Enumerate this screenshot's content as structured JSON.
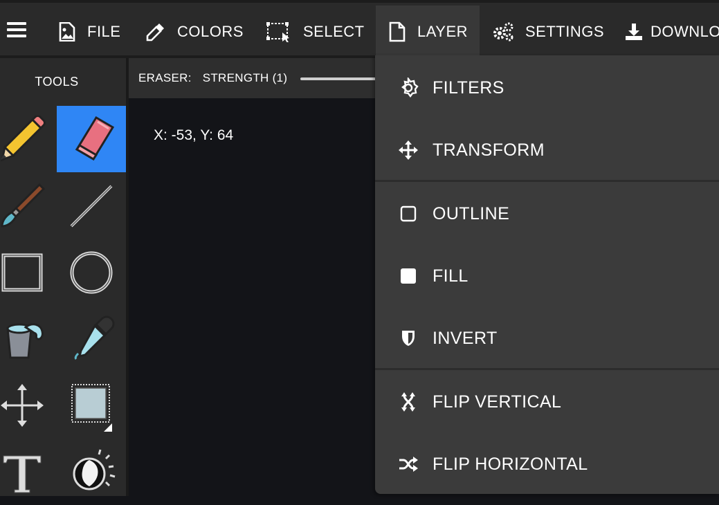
{
  "topbar": {
    "menu_icon": "hamburger-icon",
    "items": [
      {
        "label": "FILE",
        "icon": "image-file-icon"
      },
      {
        "label": "COLORS",
        "icon": "eyedropper-icon"
      },
      {
        "label": "SELECT",
        "icon": "selection-icon"
      },
      {
        "label": "LAYER",
        "icon": "document-icon",
        "active": true
      },
      {
        "label": "SETTINGS",
        "icon": "gears-icon"
      },
      {
        "label": "DOWNLO",
        "icon": "download-icon"
      }
    ]
  },
  "tools": {
    "title": "TOOLS",
    "items": [
      {
        "name": "pencil",
        "icon": "pencil-icon"
      },
      {
        "name": "eraser",
        "icon": "eraser-icon",
        "selected": true
      },
      {
        "name": "brush",
        "icon": "brush-icon"
      },
      {
        "name": "line",
        "icon": "line-icon"
      },
      {
        "name": "rectangle",
        "icon": "rectangle-icon"
      },
      {
        "name": "ellipse",
        "icon": "ellipse-icon"
      },
      {
        "name": "bucket",
        "icon": "paint-bucket-icon"
      },
      {
        "name": "eyedropper",
        "icon": "eyedropper-icon"
      },
      {
        "name": "move",
        "icon": "move-icon"
      },
      {
        "name": "selection",
        "icon": "selection-box-icon"
      },
      {
        "name": "text",
        "icon": "text-icon"
      },
      {
        "name": "lighting",
        "icon": "moon-icon"
      }
    ]
  },
  "options": {
    "tool_label": "ERASER:",
    "strength_label": "STRENGTH (1)",
    "strength_value": 1
  },
  "canvas": {
    "coords": "X: -53, Y: 64"
  },
  "layer_menu": {
    "items": [
      {
        "label": "FILTERS",
        "icon": "sun-outline-icon"
      },
      {
        "label": "TRANSFORM",
        "icon": "arrows-move-icon"
      },
      {
        "label": "OUTLINE",
        "icon": "square-outline-icon"
      },
      {
        "label": "FILL",
        "icon": "square-filled-icon"
      },
      {
        "label": "INVERT",
        "icon": "shield-half-icon"
      },
      {
        "label": "FLIP VERTICAL",
        "icon": "flip-vertical-icon"
      },
      {
        "label": "FLIP HORIZONTAL",
        "icon": "shuffle-icon"
      }
    ]
  },
  "colors": {
    "topbar_bg": "#2a2a2a",
    "canvas_bg": "#131418",
    "tool_selected": "#2f86f5",
    "menu_bg": "#3b3b3b"
  }
}
